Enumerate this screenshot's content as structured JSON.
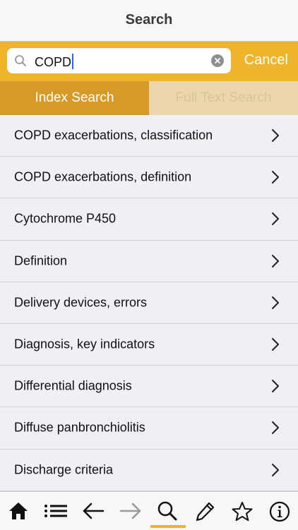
{
  "nav": {
    "title": "Search"
  },
  "search": {
    "value": "COPD",
    "cancel_label": "Cancel"
  },
  "segments": {
    "index_label": "Index Search",
    "fulltext_label": "Full Text Search",
    "active": "Index Search"
  },
  "results": [
    "COPD exacerbations, classification",
    "COPD exacerbations, definition",
    "Cytochrome P450",
    "Definition",
    "Delivery devices, errors",
    "Diagnosis, key indicators",
    "Differential diagnosis",
    "Diffuse panbronchiolitis",
    "Discharge criteria"
  ],
  "tab_bar": {
    "items": [
      "home-icon",
      "list-icon",
      "back-arrow-icon",
      "forward-arrow-icon",
      "search-icon",
      "pencil-icon",
      "star-icon",
      "info-icon"
    ],
    "active": "search-icon"
  },
  "colors": {
    "accent": "#f0b42c",
    "segment_active": "#d79a29",
    "segment_inactive": "#ecd6ab"
  }
}
